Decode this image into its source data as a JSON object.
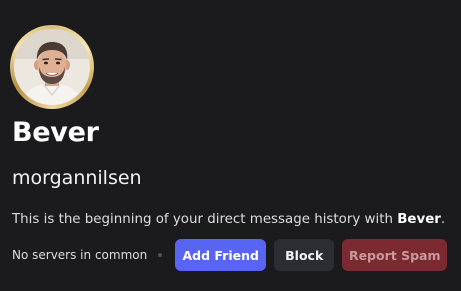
{
  "profile": {
    "display_name": "Bever",
    "username": "morgannilsen",
    "avatar_icon": "user-avatar-photo"
  },
  "intro": {
    "prefix": "This is the beginning of your direct message history with ",
    "name": "Bever",
    "suffix": "."
  },
  "actions": {
    "servers_text": "No servers in common",
    "add_friend_label": "Add Friend",
    "block_label": "Block",
    "report_spam_label": "Report Spam"
  },
  "colors": {
    "background": "#1b1b1e",
    "add_friend": "#5865f2",
    "block": "#2b2d31",
    "report_spam": "#7a2a30"
  }
}
